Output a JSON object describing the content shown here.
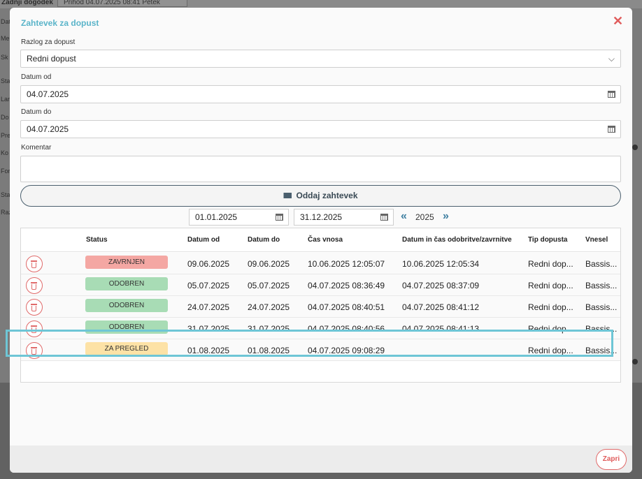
{
  "background": {
    "top_label": "Zadnji dogodek",
    "top_field": "Prihod 04.07.2025 08:41 Petek",
    "side_labels": [
      "Dat",
      "Me",
      "Sk",
      "Sta",
      "Lar",
      "Do",
      "Pre",
      "Ko",
      "For",
      "Sta",
      "Raz"
    ]
  },
  "modal": {
    "title": "Zahtevek za dopust",
    "close_icon": "close-icon"
  },
  "form": {
    "reason_label": "Razlog za dopust",
    "reason_value": "Redni dopust",
    "date_from_label": "Datum od",
    "date_from_value": "04.07.2025",
    "date_to_label": "Datum do",
    "date_to_value": "04.07.2025",
    "comment_label": "Komentar",
    "comment_value": "",
    "submit_label": "Oddaj zahtevek",
    "submit_icon": "envelope-icon"
  },
  "filter": {
    "from": "01.01.2025",
    "to": "31.12.2025",
    "prev_label": "«",
    "year": "2025",
    "next_label": "»"
  },
  "table": {
    "headers": [
      "Status",
      "Datum od",
      "Datum do",
      "Čas vnosa",
      "Datum in čas odobritve/zavrnitve",
      "Tip dopusta",
      "Vnesel"
    ],
    "rows": [
      {
        "status": "ZAVRNJEN",
        "from": "09.06.2025",
        "to": "09.06.2025",
        "created": "10.06.2025 12:05:07",
        "decided": "10.06.2025 12:05:34",
        "type": "Redni dop...",
        "by": "Bassis..."
      },
      {
        "status": "ODOBREN",
        "from": "05.07.2025",
        "to": "05.07.2025",
        "created": "04.07.2025 08:36:49",
        "decided": "04.07.2025 08:37:09",
        "type": "Redni dop...",
        "by": "Bassis..."
      },
      {
        "status": "ODOBREN",
        "from": "24.07.2025",
        "to": "24.07.2025",
        "created": "04.07.2025 08:40:51",
        "decided": "04.07.2025 08:41:12",
        "type": "Redni dop...",
        "by": "Bassis..."
      },
      {
        "status": "ODOBREN",
        "from": "31.07.2025",
        "to": "31.07.2025",
        "created": "04.07.2025 08:40:56",
        "decided": "04.07.2025 08:41:13",
        "type": "Redni dop...",
        "by": "Bassis..."
      },
      {
        "status": "ZA PREGLED",
        "from": "01.08.2025",
        "to": "01.08.2025",
        "created": "04.07.2025 09:08:29",
        "decided": "",
        "type": "Redni dop...",
        "by": "Bassis..."
      }
    ],
    "status_colors": {
      "ZAVRNJEN": "#f4a7a3",
      "ODOBREN": "#a8dcb5",
      "ZA PREGLED": "#fde2a6"
    },
    "highlight_color": "#6ec6d6"
  },
  "footer": {
    "close_label": "Zapri"
  }
}
